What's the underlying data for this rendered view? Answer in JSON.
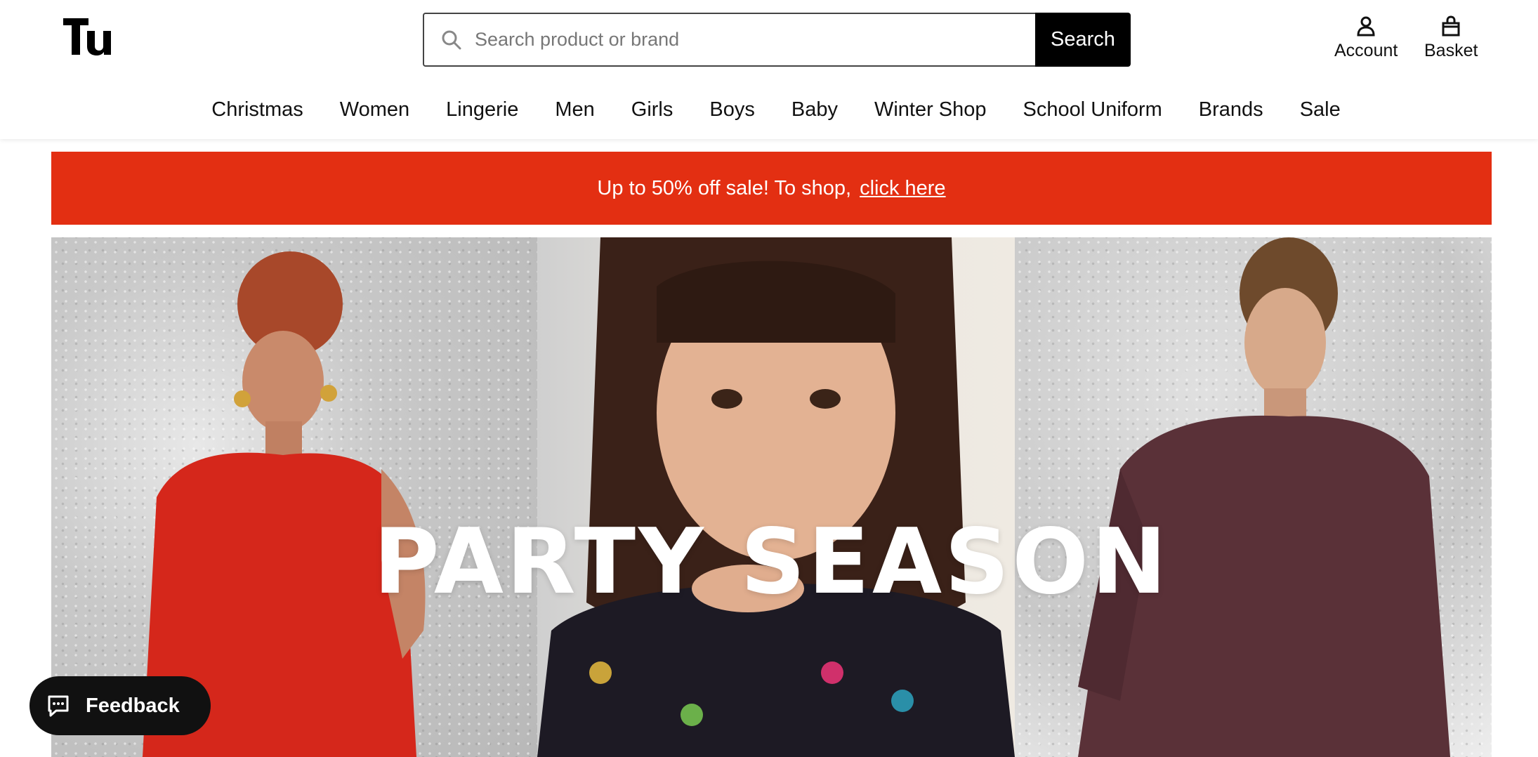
{
  "brand": {
    "logo_text": "Tu"
  },
  "search": {
    "placeholder": "Search product or brand",
    "button_label": "Search"
  },
  "header_actions": {
    "account_label": "Account",
    "basket_label": "Basket"
  },
  "nav": {
    "items": [
      "Christmas",
      "Women",
      "Lingerie",
      "Men",
      "Girls",
      "Boys",
      "Baby",
      "Winter Shop",
      "School Uniform",
      "Brands",
      "Sale"
    ]
  },
  "promo": {
    "text": "Up to 50% off sale! To shop,",
    "link": "click here",
    "color": "#e32f12"
  },
  "hero": {
    "title": "PARTY SEASON"
  },
  "feedback": {
    "label": "Feedback"
  },
  "icons": [
    "search-icon",
    "account-icon",
    "basket-icon",
    "chat-icon"
  ]
}
